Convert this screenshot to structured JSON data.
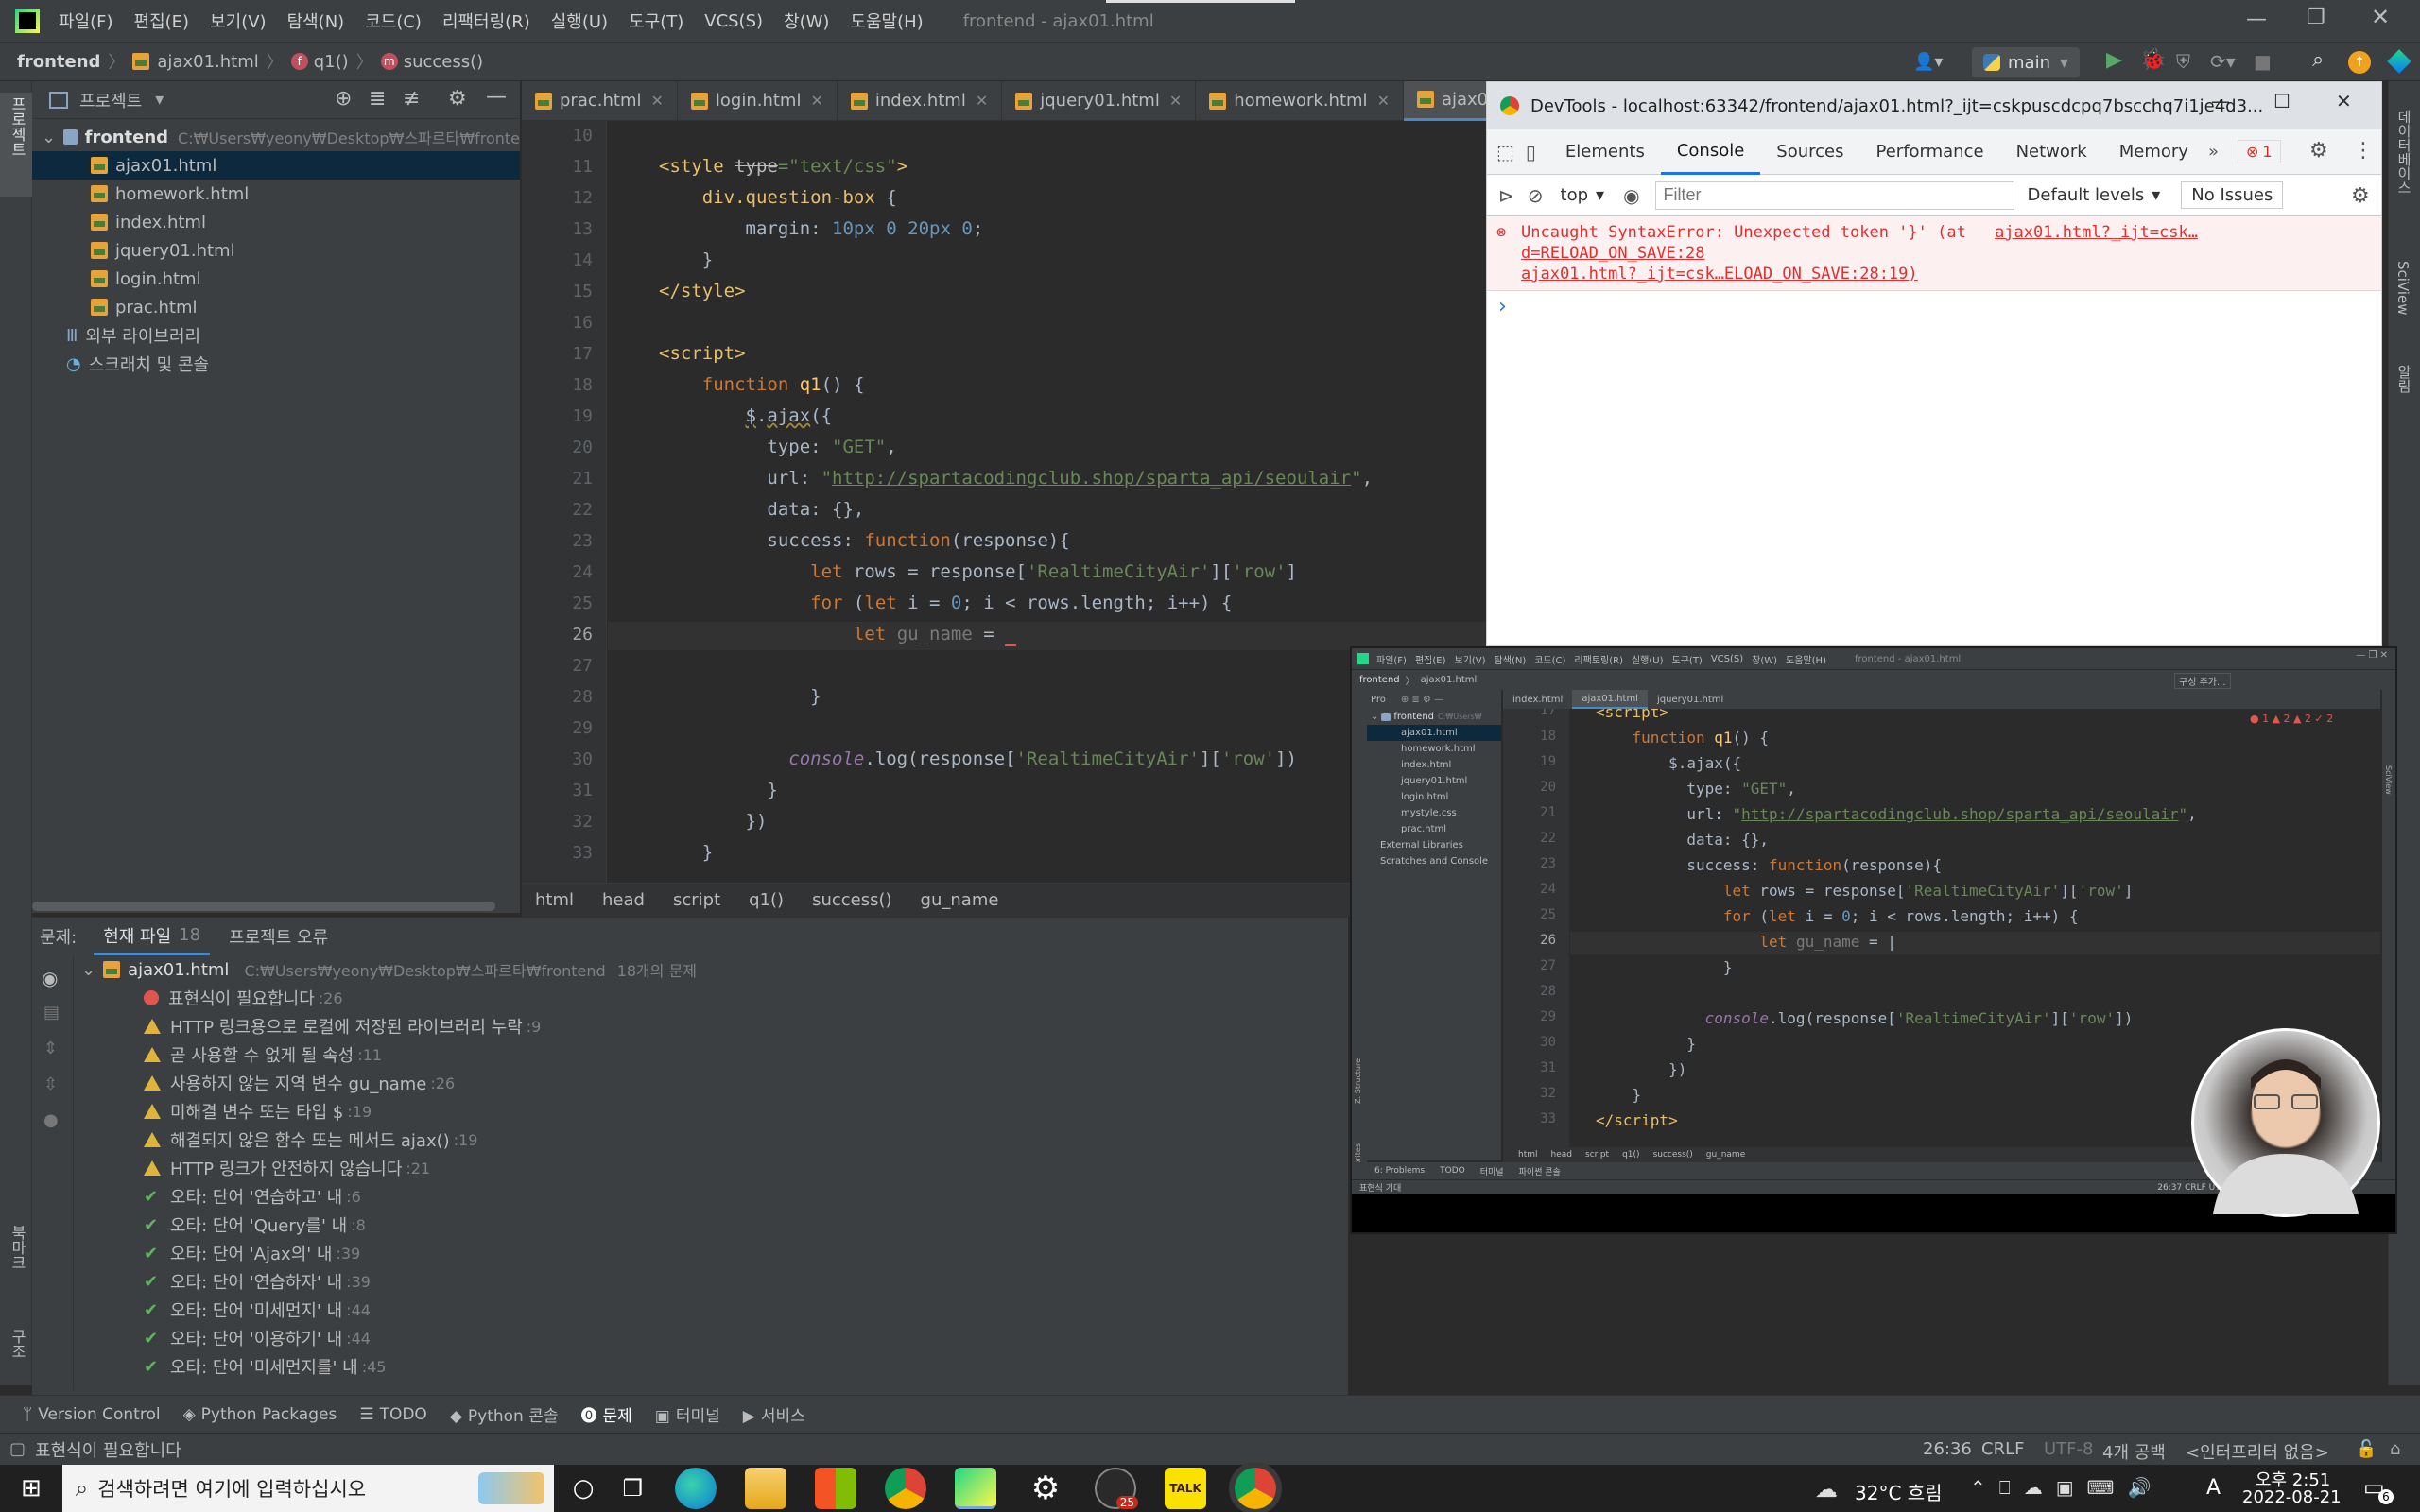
{
  "titlebar": {
    "menu": [
      "파일(F)",
      "편집(E)",
      "보기(V)",
      "탐색(N)",
      "코드(C)",
      "리팩터링(R)",
      "실행(U)",
      "도구(T)",
      "VCS(S)",
      "창(W)",
      "도움말(H)"
    ],
    "title": "frontend - ajax01.html"
  },
  "navbar": {
    "crumbs": [
      "frontend",
      "ajax01.html",
      "q1()",
      "success()"
    ],
    "branch": "main"
  },
  "project": {
    "header": "프로젝트",
    "root": "frontend",
    "root_path": "C:₩Users₩yeony₩Desktop₩스파르타₩fronte",
    "files": [
      "ajax01.html",
      "homework.html",
      "index.html",
      "jquery01.html",
      "login.html",
      "prac.html"
    ],
    "external": "외부 라이브러리",
    "scratches": "스크래치 및 콘솔"
  },
  "editor": {
    "tabs": [
      "prac.html",
      "login.html",
      "index.html",
      "jquery01.html",
      "homework.html",
      "ajax01.html"
    ],
    "line_numbers": [
      "10",
      "11",
      "12",
      "13",
      "14",
      "15",
      "16",
      "17",
      "18",
      "19",
      "20",
      "21",
      "22",
      "23",
      "24",
      "25",
      "26",
      "27",
      "28",
      "29",
      "30",
      "31",
      "32",
      "33"
    ],
    "breadcrumb": [
      "html",
      "head",
      "script",
      "q1()",
      "success()",
      "gu_name"
    ]
  },
  "devtools": {
    "title": "DevTools - localhost:63342/frontend/ajax01.html?_ijt=cskpuscdcpq7bscchq7i1je4d3...",
    "tabs": [
      "Elements",
      "Console",
      "Sources",
      "Performance",
      "Network",
      "Memory"
    ],
    "more": "»",
    "error_badge": "1",
    "context": "top",
    "filter_placeholder": "Filter",
    "levels": "Default levels",
    "issues": "No Issues",
    "error_line1": "Uncaught SyntaxError: Unexpected token '}' (at",
    "error_link1": "ajax01.html?_ijt=csk…d=RELOAD_ON_SAVE:28",
    "error_line2": "ajax01.html?_ijt=csk…ELOAD_ON_SAVE:28:19)",
    "prompt": "›"
  },
  "problems": {
    "label": "문제:",
    "tab_current": "현재 파일",
    "tab_current_count": "18",
    "tab_project": "프로젝트 오류",
    "file": "ajax01.html",
    "file_path": "C:₩Users₩yeony₩Desktop₩스파르타₩frontend",
    "file_count": "18개의 문제",
    "items": [
      {
        "kind": "error",
        "text": "표현식이 필요합니다",
        "loc": ":26"
      },
      {
        "kind": "warn",
        "text": "HTTP 링크용으로 로컬에 저장된 라이브러리 누락",
        "loc": ":9"
      },
      {
        "kind": "warn",
        "text": "곧 사용할 수 없게 될 속성",
        "loc": ":11"
      },
      {
        "kind": "warn",
        "text": "사용하지 않는 지역 변수 gu_name",
        "loc": ":26"
      },
      {
        "kind": "warn",
        "text": "미해결 변수 또는 타입 $",
        "loc": ":19"
      },
      {
        "kind": "warn",
        "text": "해결되지 않은 함수 또는 메서드 ajax()",
        "loc": ":19"
      },
      {
        "kind": "warn",
        "text": "HTTP 링크가 안전하지 않습니다",
        "loc": ":21"
      },
      {
        "kind": "typo",
        "text": "오타: 단어 '연습하고' 내",
        "loc": ":6"
      },
      {
        "kind": "typo",
        "text": "오타: 단어 'Query를' 내",
        "loc": ":8"
      },
      {
        "kind": "typo",
        "text": "오타: 단어 'Ajax의' 내",
        "loc": ":39"
      },
      {
        "kind": "typo",
        "text": "오타: 단어 '연습하자' 내",
        "loc": ":39"
      },
      {
        "kind": "typo",
        "text": "오타: 단어 '미세먼지' 내",
        "loc": ":44"
      },
      {
        "kind": "typo",
        "text": "오타: 단어 '이용하기' 내",
        "loc": ":44"
      },
      {
        "kind": "typo",
        "text": "오타: 단어 '미세먼지를' 내",
        "loc": ":45"
      }
    ]
  },
  "toolwindows": [
    "Version Control",
    "Python Packages",
    "TODO",
    "Python 콘솔",
    "문제",
    "터미널",
    "서비스"
  ],
  "status": {
    "message": "표현식이 필요합니다",
    "position": "26:36",
    "line_sep": "CRLF",
    "encoding": "UTF-8",
    "indent": "4개 공백",
    "interpreter": "<인터프리터 없음>"
  },
  "overlay": {
    "menu": [
      "파일(F)",
      "편집(E)",
      "보기(V)",
      "탐색(N)",
      "코드(C)",
      "리팩토링(R)",
      "실행(U)",
      "도구(T)",
      "VCS(S)",
      "창(W)",
      "도움말(H)"
    ],
    "title": "frontend - ajax01.html",
    "crumbs": [
      "frontend",
      "ajax01.html"
    ],
    "config_btn": "구성 추가...",
    "tabs": [
      "index.html",
      "ajax01.html",
      "jquery01.html"
    ],
    "project_label": "Pro",
    "root": "frontend",
    "root_path": "C:₩Users₩",
    "files": [
      "ajax01.html",
      "homework.html",
      "index.html",
      "jquery01.html",
      "login.html",
      "mystyle.css",
      "prac.html"
    ],
    "external": "External Libraries",
    "scratches": "Scratches and Console",
    "inspection": "● 1 ▲ 2 ▲ 2 ✓ 2",
    "line_numbers": [
      "17",
      "18",
      "19",
      "20",
      "21",
      "22",
      "23",
      "24",
      "25",
      "26",
      "27",
      "28",
      "29",
      "30",
      "31",
      "32",
      "33"
    ],
    "breadcrumb": [
      "html",
      "head",
      "script",
      "q1()",
      "success()",
      "gu_name"
    ],
    "bottom_tabs": [
      "6: Problems",
      "TODO",
      "터미널",
      "파이썬 콘솔"
    ],
    "status_left": "표현식 기대",
    "status_right": "26:37  CRLF  UTF-8",
    "side_structure": "Z: Structure",
    "side_favorites": "Favorites",
    "side_sciview": "SciView"
  },
  "side_labels": {
    "left_top": "프로젝트",
    "left_bottom1": "북마크",
    "left_bottom2": "구조",
    "right1": "데이터베이스",
    "right2": "SciView",
    "right3": "알림"
  },
  "taskbar": {
    "search": "검색하려면 여기에 입력하십시오",
    "weather": "32°C 흐림",
    "time": "오후 2:51",
    "date": "2022-08-21",
    "ime": "A",
    "badge_notify": "6",
    "badge_app": "25"
  }
}
